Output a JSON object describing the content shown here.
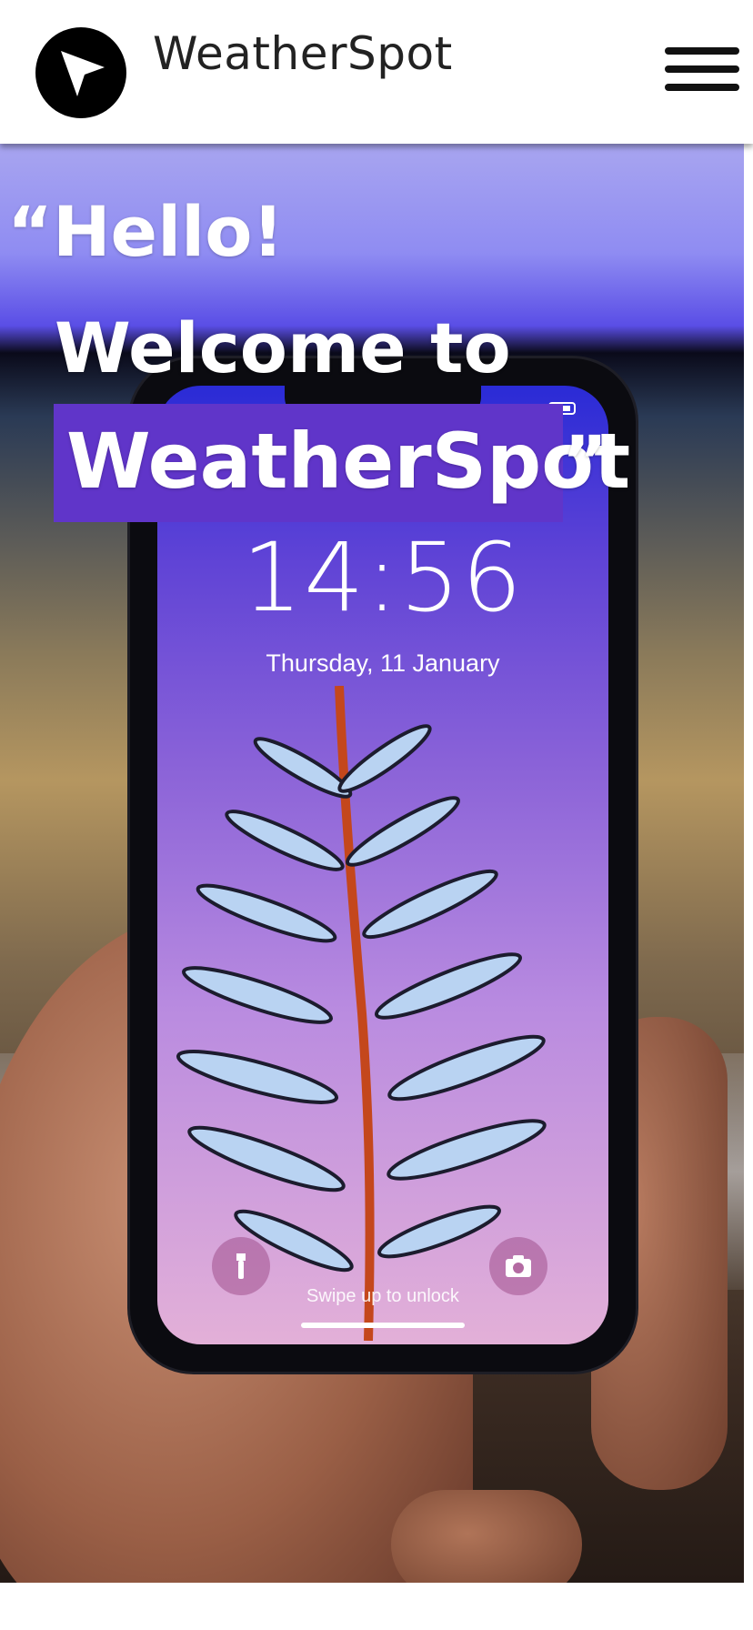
{
  "header": {
    "brand": "WeatherSpot",
    "logo_icon": "navigation-arrow-icon",
    "menu_icon": "hamburger-menu-icon"
  },
  "hero": {
    "quote_line1": "“Hello!",
    "quote_line2": "Welcome to",
    "quote_brand": "WeatherSpot",
    "quote_close": "”",
    "highlight_color": "#6035c9"
  },
  "phone_screen": {
    "time": "14:56",
    "date": "Thursday, 11 January",
    "swipe_hint": "Swipe up to unlock",
    "left_button_icon": "flashlight-icon",
    "right_button_icon": "camera-icon"
  }
}
